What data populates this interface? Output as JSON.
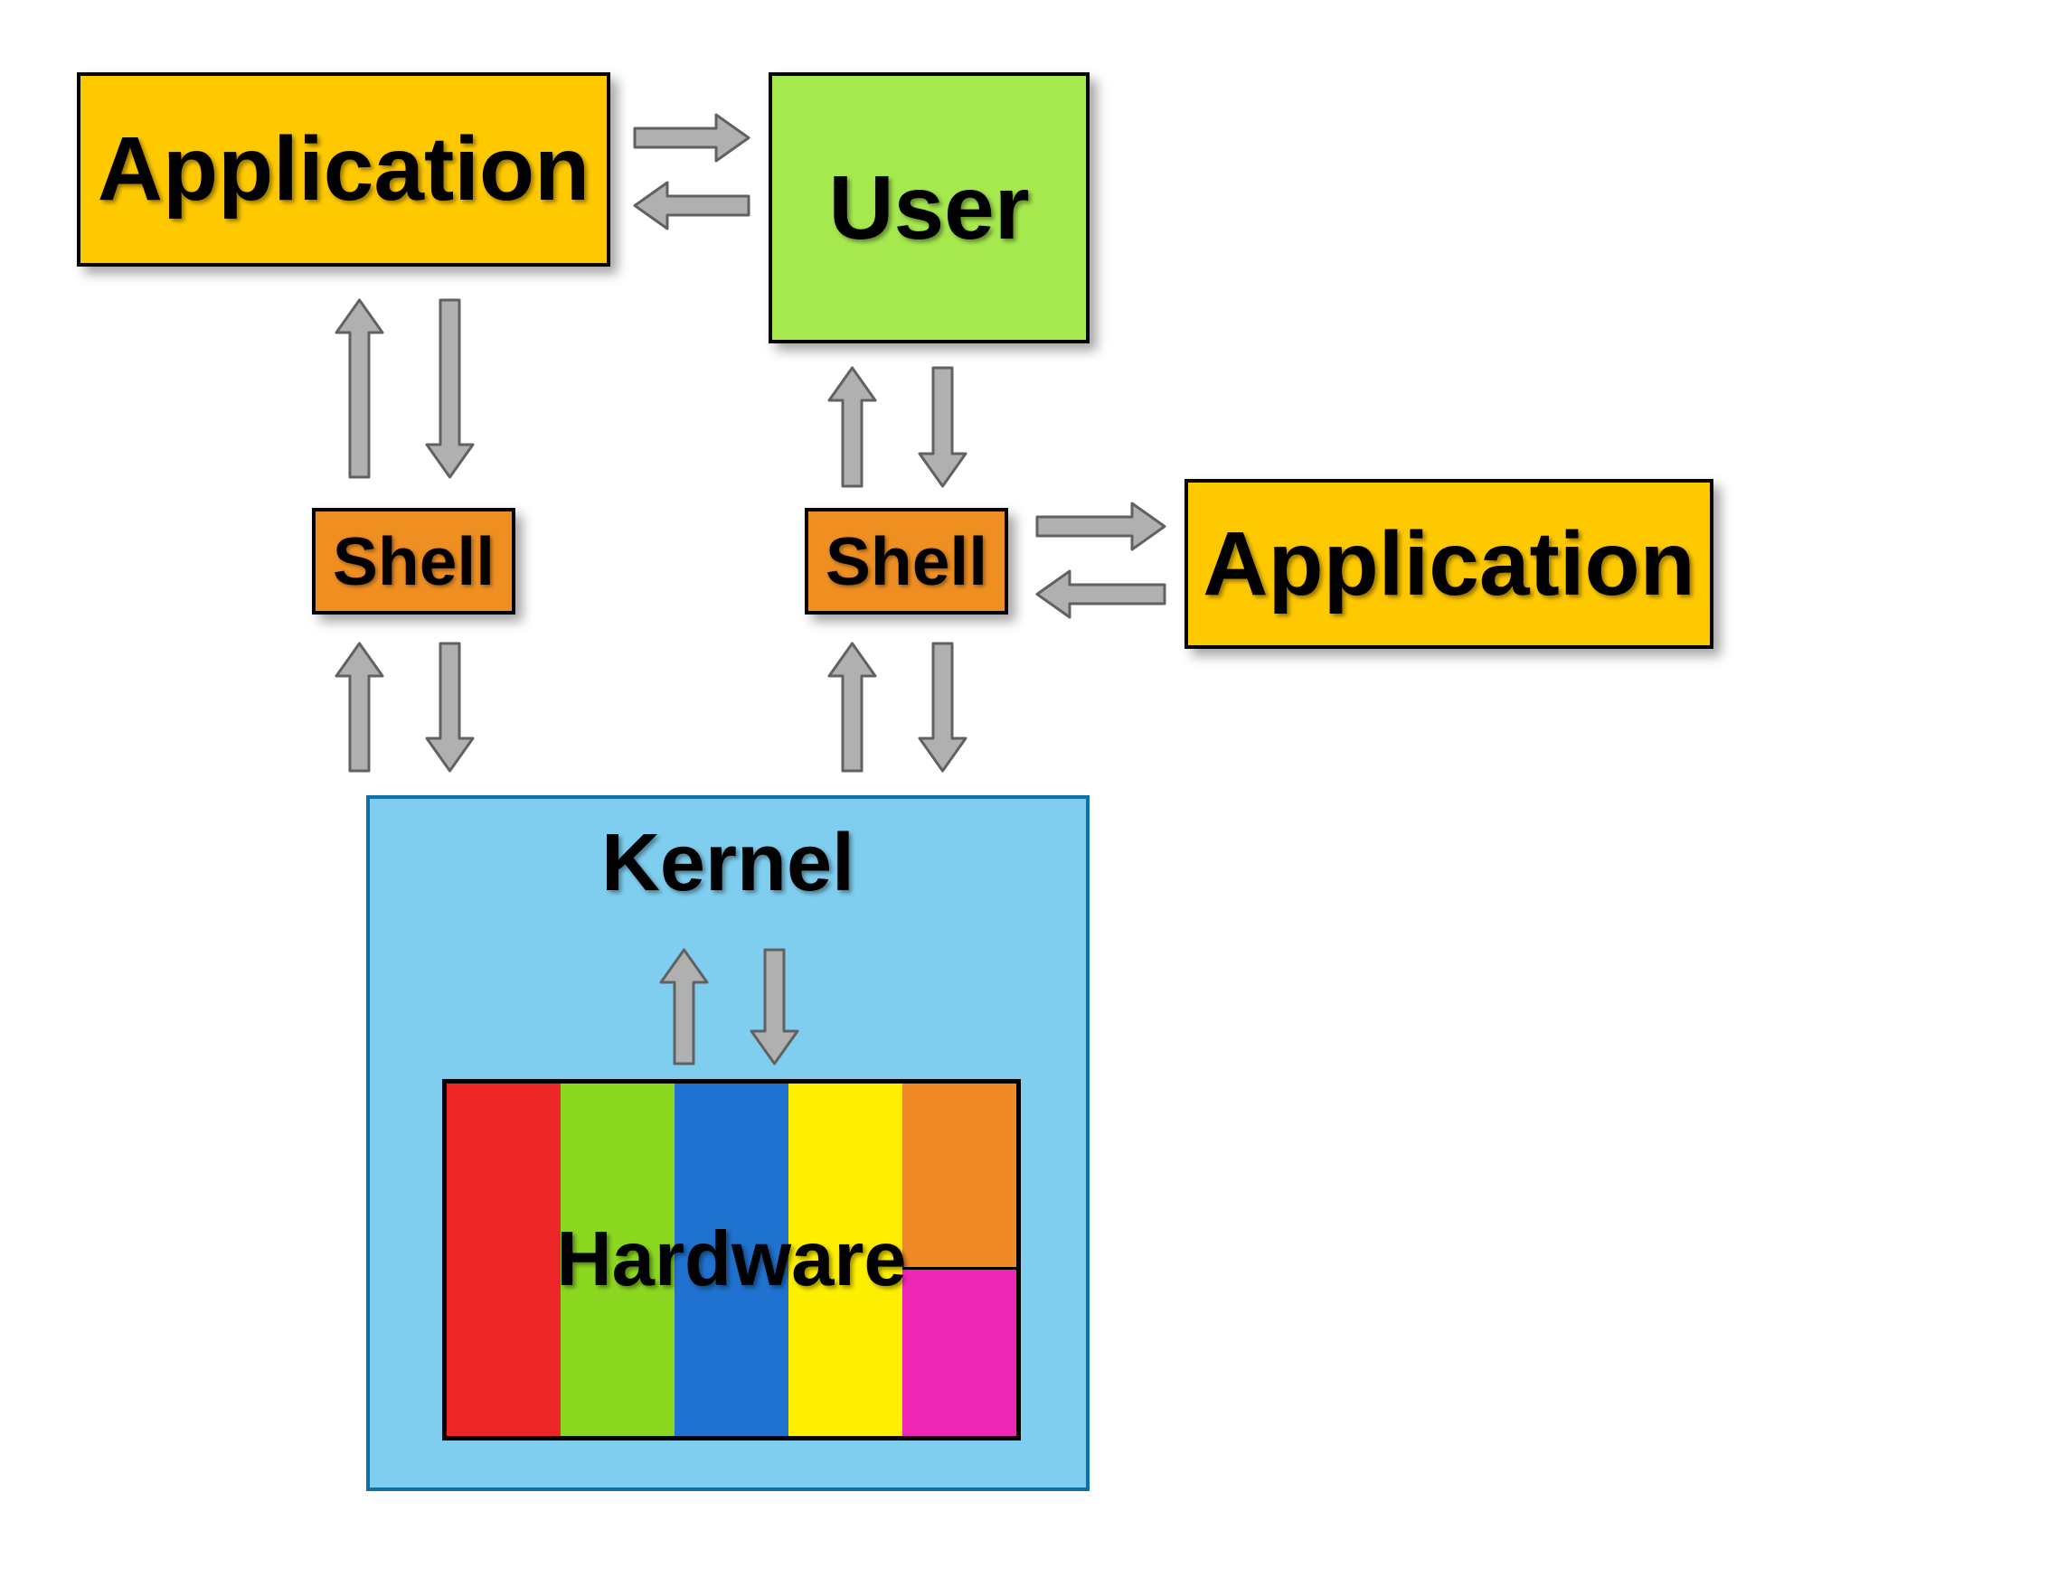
{
  "boxes": {
    "application_top": "Application",
    "user": "User",
    "shell_left": "Shell",
    "shell_right": "Shell",
    "application_right": "Application",
    "kernel": "Kernel",
    "hardware": "Hardware"
  },
  "colors": {
    "application": "#ffc900",
    "user": "#a6e94f",
    "shell": "#ef8f22",
    "kernel_bg": "#7fceef",
    "kernel_border": "#0f70a5",
    "arrow_fill": "#b0b0b0",
    "arrow_stroke": "#616161",
    "hardware_stripes": [
      "#ed2727",
      "#8cd820",
      "#1f72cf",
      "#ffef00",
      "#f08a24",
      "#ed27b4"
    ]
  },
  "relationships": [
    {
      "from": "application_top",
      "to": "user",
      "dir": "both"
    },
    {
      "from": "application_top",
      "to": "shell_left",
      "dir": "both"
    },
    {
      "from": "user",
      "to": "shell_right",
      "dir": "both"
    },
    {
      "from": "shell_right",
      "to": "application_right",
      "dir": "both"
    },
    {
      "from": "shell_left",
      "to": "kernel",
      "dir": "both"
    },
    {
      "from": "shell_right",
      "to": "kernel",
      "dir": "both"
    },
    {
      "from": "kernel",
      "to": "hardware",
      "dir": "both"
    }
  ]
}
